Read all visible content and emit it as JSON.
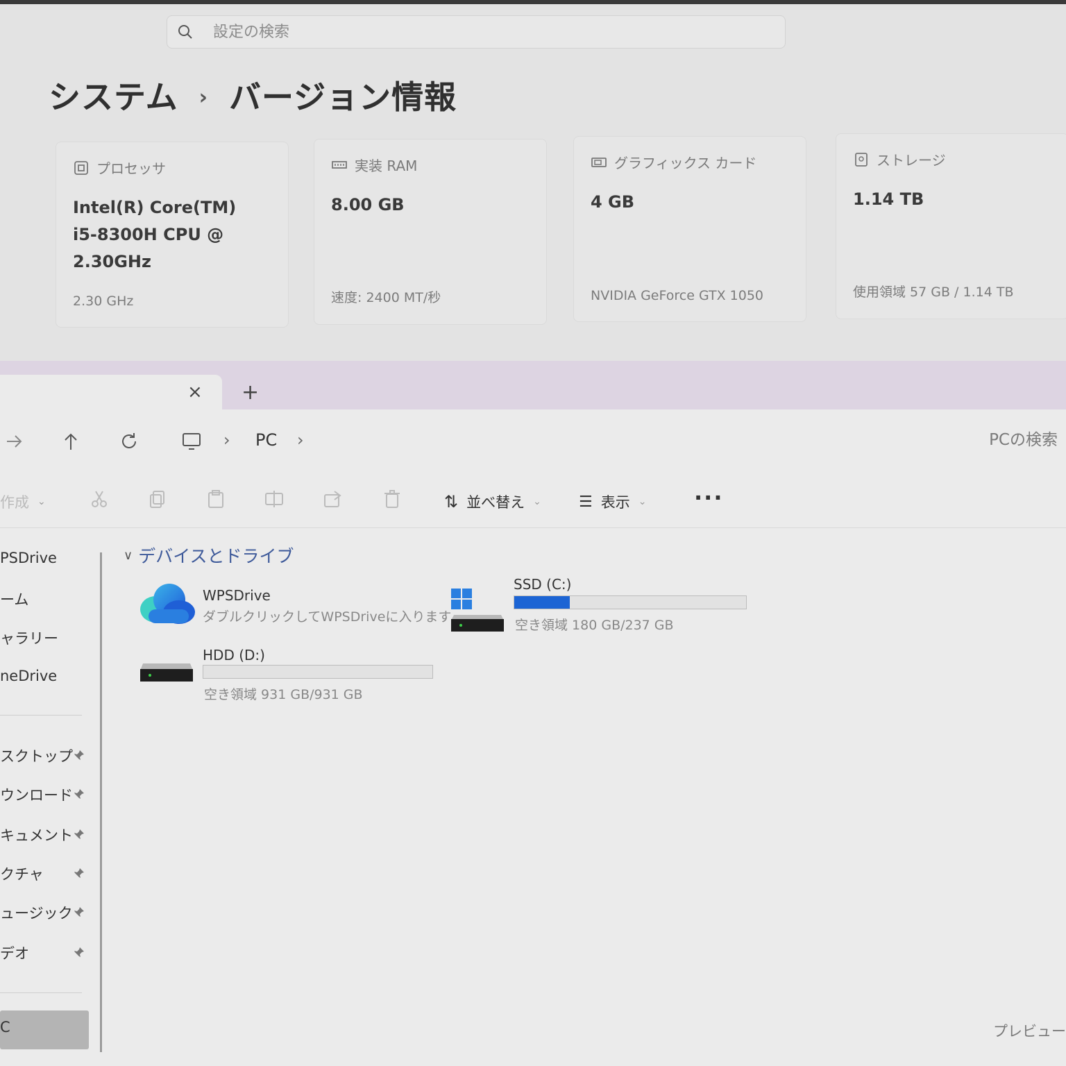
{
  "settings": {
    "search_placeholder": "設定の検索",
    "breadcrumb_parent": "システム",
    "breadcrumb_current": "バージョン情報",
    "cards": [
      {
        "caption": "プロセッサ",
        "value_lines": [
          "Intel(R) Core(TM)",
          "i5-8300H CPU @",
          "2.30GHz"
        ],
        "sub": "2.30 GHz",
        "icon": "processor-icon"
      },
      {
        "caption": "実装 RAM",
        "value_lines": [
          "8.00 GB"
        ],
        "sub": "速度: 2400 MT/秒",
        "icon": "ram-icon"
      },
      {
        "caption": "グラフィックス カード",
        "value_lines": [
          "4 GB"
        ],
        "sub": "NVIDIA GeForce GTX 1050",
        "icon": "graphics-card-icon"
      },
      {
        "caption": "ストレージ",
        "value_lines": [
          "1.14 TB"
        ],
        "sub": "使用領域 57 GB / 1.14 TB",
        "icon": "storage-icon"
      }
    ]
  },
  "explorer": {
    "tab_close": "×",
    "new_tab": "+",
    "breadcrumb": [
      "PC"
    ],
    "search_placeholder": "PCの検索",
    "toolbar": {
      "new_label": "作成",
      "sort_label": "並べ替え",
      "view_label": "表示",
      "more_label": "···"
    },
    "sidebar": {
      "top_items": [
        "PSDrive",
        "ーム",
        "ャラリー",
        "neDrive"
      ],
      "pinned_items": [
        "スクトップ",
        "ウンロード",
        "キュメント",
        "クチャ",
        "ュージック",
        "デオ"
      ],
      "selected_label": "C"
    },
    "group_header": "デバイスとドライブ",
    "drives": {
      "wps": {
        "name": "WPSDrive",
        "desc": "ダブルクリックしてWPSDriveに入ります"
      },
      "ssd": {
        "name": "SSD (C:)",
        "desc": "空き領域 180 GB/237 GB",
        "used_fraction": 0.24
      },
      "hdd": {
        "name": "HDD (D:)",
        "desc": "空き領域 931 GB/931 GB",
        "used_fraction": 0.0
      }
    },
    "preview_label": "プレビュー"
  },
  "colors": {
    "accent": "#1c64d4",
    "group_header": "#3e5a9a",
    "tabbar": "#ddd4e2"
  }
}
